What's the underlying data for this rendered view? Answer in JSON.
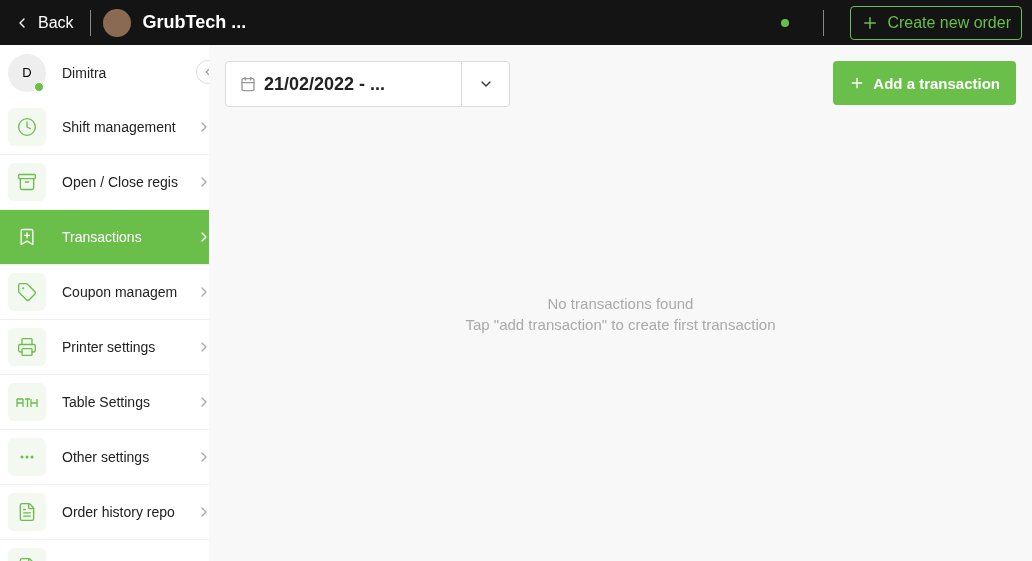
{
  "top_bar": {
    "back": "Back",
    "store_name": "GrubTech ...",
    "online": true,
    "create_order": "Create new order"
  },
  "user": {
    "initial": "D",
    "name": "Dimitra",
    "online": true
  },
  "sidebar": {
    "items": [
      {
        "label": "Shift management",
        "kind": "clock",
        "selected": false
      },
      {
        "label": "Open / Close regis",
        "kind": "archive",
        "selected": false
      },
      {
        "label": "Transactions",
        "kind": "bookmark",
        "selected": true
      },
      {
        "label": "Coupon managem",
        "kind": "tag",
        "selected": false
      },
      {
        "label": "Printer settings",
        "kind": "printer",
        "selected": false
      },
      {
        "label": "Table Settings",
        "kind": "table",
        "selected": false
      },
      {
        "label": "Other settings",
        "kind": "dots",
        "selected": false
      },
      {
        "label": "Order history repo",
        "kind": "document",
        "selected": false
      }
    ]
  },
  "date_filter": {
    "value": "21/02/2022 - ..."
  },
  "add_button": "Add a transaction",
  "empty_state": {
    "title": "No transactions found",
    "hint": "Tap \"add transaction\" to create first transaction"
  }
}
